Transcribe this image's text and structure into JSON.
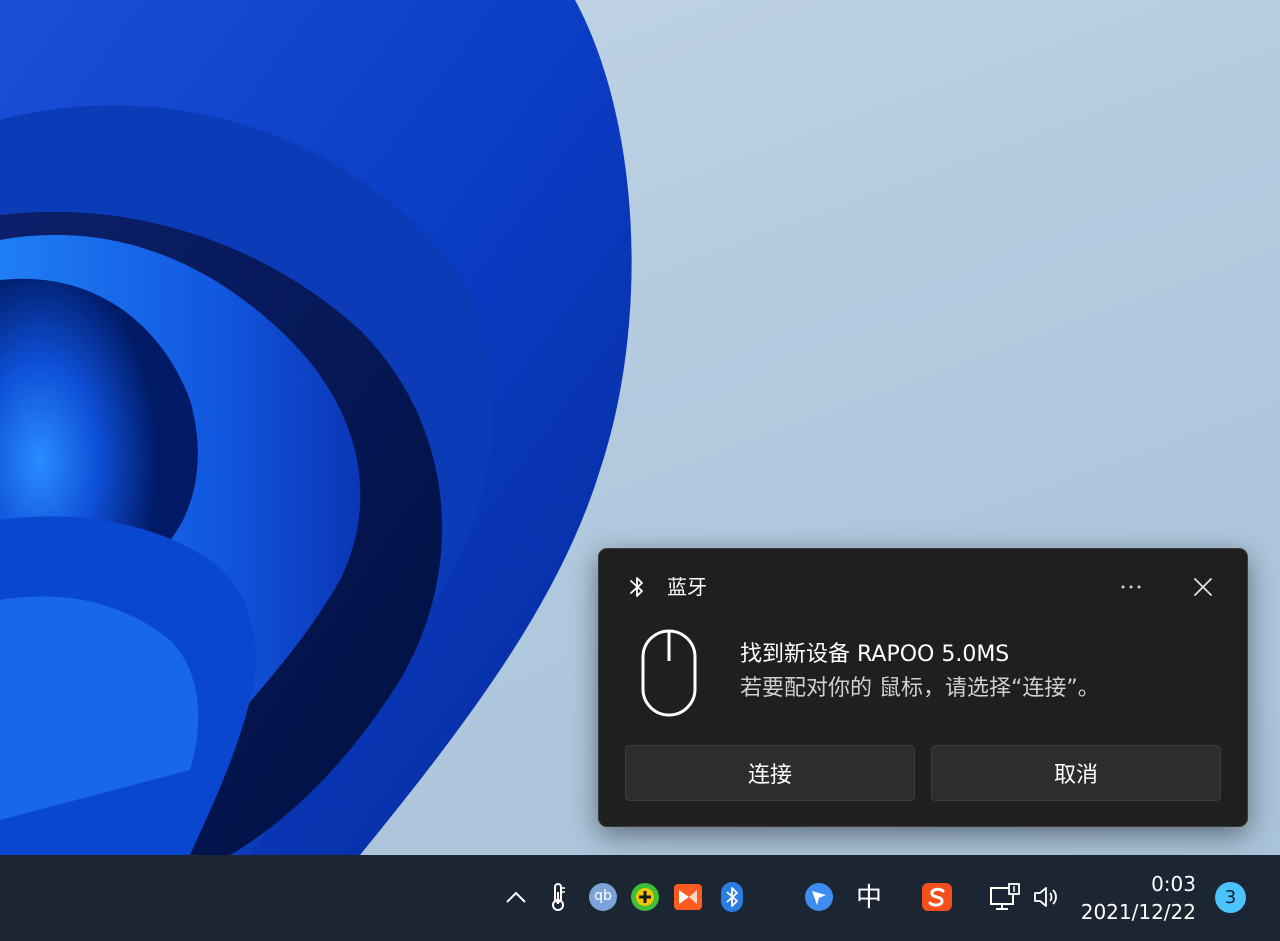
{
  "notification": {
    "app_name": "蓝牙",
    "app_icon": "bluetooth-icon",
    "device_icon": "mouse-icon",
    "title": "找到新设备 RAPOO 5.0MS",
    "body": "若要配对你的 鼠标，请选择“连接”。",
    "more_icon": "ellipsis-icon",
    "close_icon": "close-icon",
    "buttons": {
      "connect": "连接",
      "cancel": "取消"
    }
  },
  "taskbar": {
    "tray_icons": [
      "chevron-up-icon",
      "thermometer-icon",
      "qbittorrent-icon",
      "green-app-icon",
      "orange-app-icon",
      "bluetooth-icon",
      "feishu-icon",
      "sogou-icon",
      "network-icon",
      "volume-icon"
    ],
    "qb_label": "qb",
    "ime_label": "中",
    "time": "0:03",
    "date": "2021/12/22",
    "notification_count": "3"
  },
  "colors": {
    "toast_bg": "#1f1f1f",
    "button_bg": "#2d2d2d",
    "taskbar_bg": "#1c2633",
    "accent": "#4cc2ff",
    "wallpaper_blue": "#0f52d6"
  }
}
